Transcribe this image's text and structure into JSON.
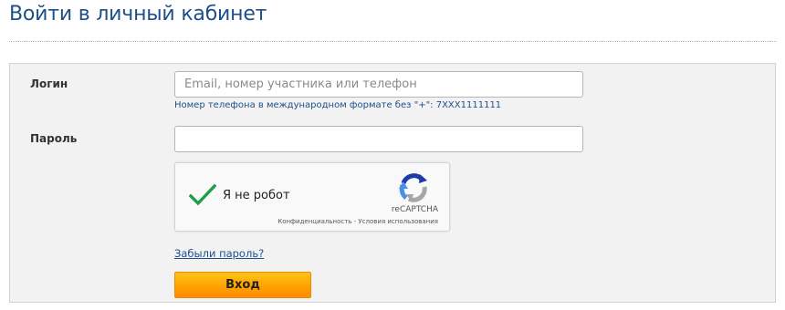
{
  "page": {
    "title": "Войти в личный кабинет"
  },
  "form": {
    "login": {
      "label": "Логин",
      "value": "",
      "placeholder": "Email, номер участника или телефон",
      "hint": "Номер телефона в международном формате без \"+\": 7XXX1111111"
    },
    "password": {
      "label": "Пароль",
      "value": "",
      "placeholder": ""
    },
    "captcha": {
      "label": "Я не робот",
      "checked": true,
      "brand": "reCAPTCHA",
      "links": "Конфиденциальность - Условия использования",
      "check_color": "#1e9e48",
      "icon": "recaptcha-logo"
    },
    "forgot_link": "Забыли пароль?",
    "submit_label": "Вход"
  },
  "colors": {
    "title": "#1f4f89",
    "link": "#1f4f89",
    "button": "#ffa200",
    "panel": "#f2f2f2"
  }
}
